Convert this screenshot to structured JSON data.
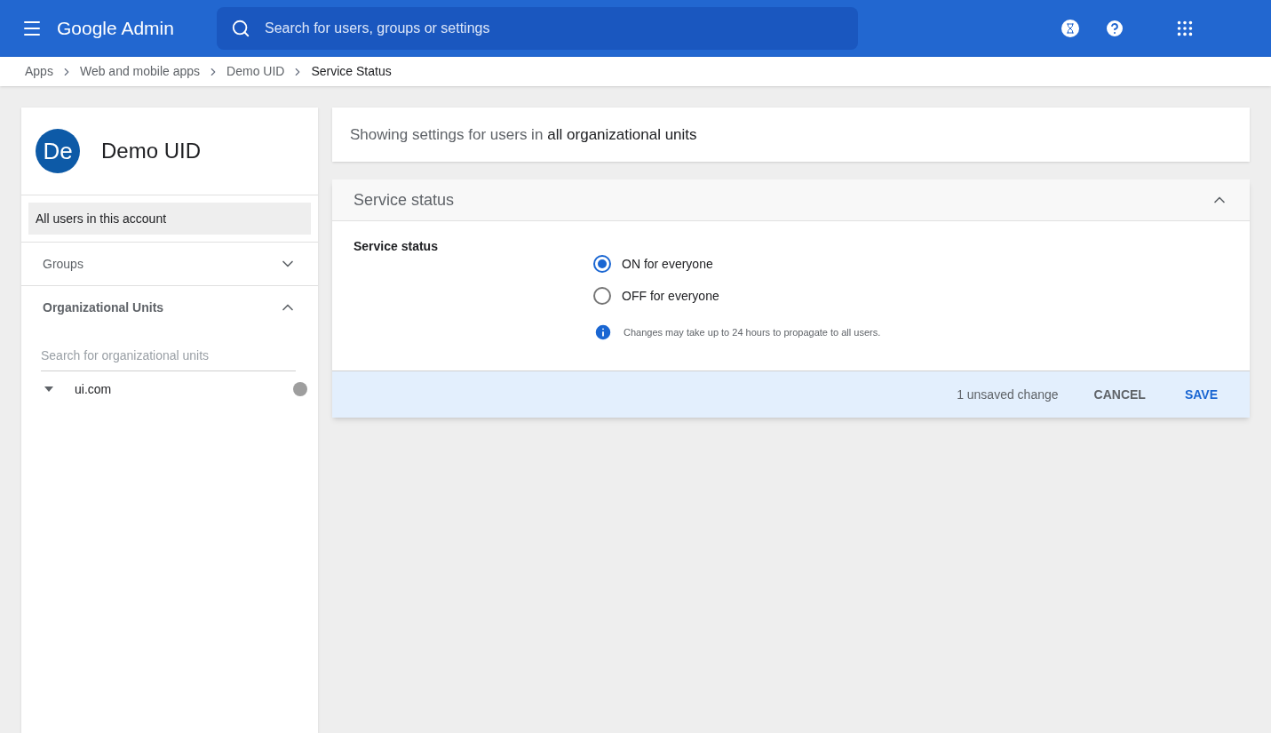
{
  "header": {
    "product": "Google Admin",
    "search_placeholder": "Search for users, groups or settings"
  },
  "breadcrumbs": [
    {
      "label": "Apps",
      "current": false
    },
    {
      "label": "Web and mobile apps",
      "current": false
    },
    {
      "label": "Demo UID",
      "current": false
    },
    {
      "label": "Service Status",
      "current": true
    }
  ],
  "sidebar": {
    "app": {
      "avatar": "De",
      "name": "Demo UID"
    },
    "scope": {
      "label": "All users in this account",
      "selected": true
    },
    "sections": [
      {
        "title": "Groups",
        "expanded": false
      },
      {
        "title": "Organizational Units",
        "expanded": true
      }
    ],
    "ou_search_placeholder": "Search for organizational units",
    "tree": [
      {
        "label": "ui.com",
        "expanded": true
      }
    ]
  },
  "scope_banner": {
    "prefix": "Showing settings for users in",
    "target": "all organizational units"
  },
  "panel": {
    "title": "Service status",
    "expanded": true,
    "setting_label": "Service status",
    "options": [
      {
        "label": "ON for everyone",
        "selected": true
      },
      {
        "label": "OFF for everyone",
        "selected": false
      }
    ],
    "note": "Changes may take up to 24 hours to propagate to all users.",
    "footer": {
      "status": "1 unsaved change",
      "buttons": [
        {
          "label": "CANCEL",
          "kind": "secondary"
        },
        {
          "label": "SAVE",
          "kind": "primary"
        }
      ]
    }
  }
}
